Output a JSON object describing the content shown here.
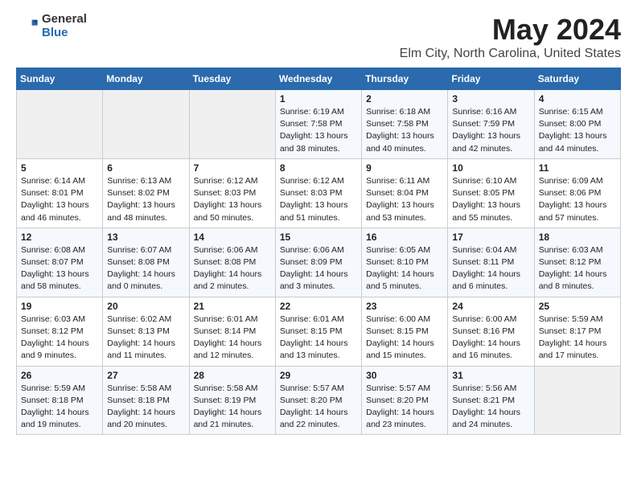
{
  "logo": {
    "general": "General",
    "blue": "Blue"
  },
  "title": "May 2024",
  "subtitle": "Elm City, North Carolina, United States",
  "days_header": [
    "Sunday",
    "Monday",
    "Tuesday",
    "Wednesday",
    "Thursday",
    "Friday",
    "Saturday"
  ],
  "weeks": [
    [
      {
        "day": "",
        "content": ""
      },
      {
        "day": "",
        "content": ""
      },
      {
        "day": "",
        "content": ""
      },
      {
        "day": "1",
        "content": "Sunrise: 6:19 AM\nSunset: 7:58 PM\nDaylight: 13 hours and 38 minutes."
      },
      {
        "day": "2",
        "content": "Sunrise: 6:18 AM\nSunset: 7:58 PM\nDaylight: 13 hours and 40 minutes."
      },
      {
        "day": "3",
        "content": "Sunrise: 6:16 AM\nSunset: 7:59 PM\nDaylight: 13 hours and 42 minutes."
      },
      {
        "day": "4",
        "content": "Sunrise: 6:15 AM\nSunset: 8:00 PM\nDaylight: 13 hours and 44 minutes."
      }
    ],
    [
      {
        "day": "5",
        "content": "Sunrise: 6:14 AM\nSunset: 8:01 PM\nDaylight: 13 hours and 46 minutes."
      },
      {
        "day": "6",
        "content": "Sunrise: 6:13 AM\nSunset: 8:02 PM\nDaylight: 13 hours and 48 minutes."
      },
      {
        "day": "7",
        "content": "Sunrise: 6:12 AM\nSunset: 8:03 PM\nDaylight: 13 hours and 50 minutes."
      },
      {
        "day": "8",
        "content": "Sunrise: 6:12 AM\nSunset: 8:03 PM\nDaylight: 13 hours and 51 minutes."
      },
      {
        "day": "9",
        "content": "Sunrise: 6:11 AM\nSunset: 8:04 PM\nDaylight: 13 hours and 53 minutes."
      },
      {
        "day": "10",
        "content": "Sunrise: 6:10 AM\nSunset: 8:05 PM\nDaylight: 13 hours and 55 minutes."
      },
      {
        "day": "11",
        "content": "Sunrise: 6:09 AM\nSunset: 8:06 PM\nDaylight: 13 hours and 57 minutes."
      }
    ],
    [
      {
        "day": "12",
        "content": "Sunrise: 6:08 AM\nSunset: 8:07 PM\nDaylight: 13 hours and 58 minutes."
      },
      {
        "day": "13",
        "content": "Sunrise: 6:07 AM\nSunset: 8:08 PM\nDaylight: 14 hours and 0 minutes."
      },
      {
        "day": "14",
        "content": "Sunrise: 6:06 AM\nSunset: 8:08 PM\nDaylight: 14 hours and 2 minutes."
      },
      {
        "day": "15",
        "content": "Sunrise: 6:06 AM\nSunset: 8:09 PM\nDaylight: 14 hours and 3 minutes."
      },
      {
        "day": "16",
        "content": "Sunrise: 6:05 AM\nSunset: 8:10 PM\nDaylight: 14 hours and 5 minutes."
      },
      {
        "day": "17",
        "content": "Sunrise: 6:04 AM\nSunset: 8:11 PM\nDaylight: 14 hours and 6 minutes."
      },
      {
        "day": "18",
        "content": "Sunrise: 6:03 AM\nSunset: 8:12 PM\nDaylight: 14 hours and 8 minutes."
      }
    ],
    [
      {
        "day": "19",
        "content": "Sunrise: 6:03 AM\nSunset: 8:12 PM\nDaylight: 14 hours and 9 minutes."
      },
      {
        "day": "20",
        "content": "Sunrise: 6:02 AM\nSunset: 8:13 PM\nDaylight: 14 hours and 11 minutes."
      },
      {
        "day": "21",
        "content": "Sunrise: 6:01 AM\nSunset: 8:14 PM\nDaylight: 14 hours and 12 minutes."
      },
      {
        "day": "22",
        "content": "Sunrise: 6:01 AM\nSunset: 8:15 PM\nDaylight: 14 hours and 13 minutes."
      },
      {
        "day": "23",
        "content": "Sunrise: 6:00 AM\nSunset: 8:15 PM\nDaylight: 14 hours and 15 minutes."
      },
      {
        "day": "24",
        "content": "Sunrise: 6:00 AM\nSunset: 8:16 PM\nDaylight: 14 hours and 16 minutes."
      },
      {
        "day": "25",
        "content": "Sunrise: 5:59 AM\nSunset: 8:17 PM\nDaylight: 14 hours and 17 minutes."
      }
    ],
    [
      {
        "day": "26",
        "content": "Sunrise: 5:59 AM\nSunset: 8:18 PM\nDaylight: 14 hours and 19 minutes."
      },
      {
        "day": "27",
        "content": "Sunrise: 5:58 AM\nSunset: 8:18 PM\nDaylight: 14 hours and 20 minutes."
      },
      {
        "day": "28",
        "content": "Sunrise: 5:58 AM\nSunset: 8:19 PM\nDaylight: 14 hours and 21 minutes."
      },
      {
        "day": "29",
        "content": "Sunrise: 5:57 AM\nSunset: 8:20 PM\nDaylight: 14 hours and 22 minutes."
      },
      {
        "day": "30",
        "content": "Sunrise: 5:57 AM\nSunset: 8:20 PM\nDaylight: 14 hours and 23 minutes."
      },
      {
        "day": "31",
        "content": "Sunrise: 5:56 AM\nSunset: 8:21 PM\nDaylight: 14 hours and 24 minutes."
      },
      {
        "day": "",
        "content": ""
      }
    ]
  ]
}
